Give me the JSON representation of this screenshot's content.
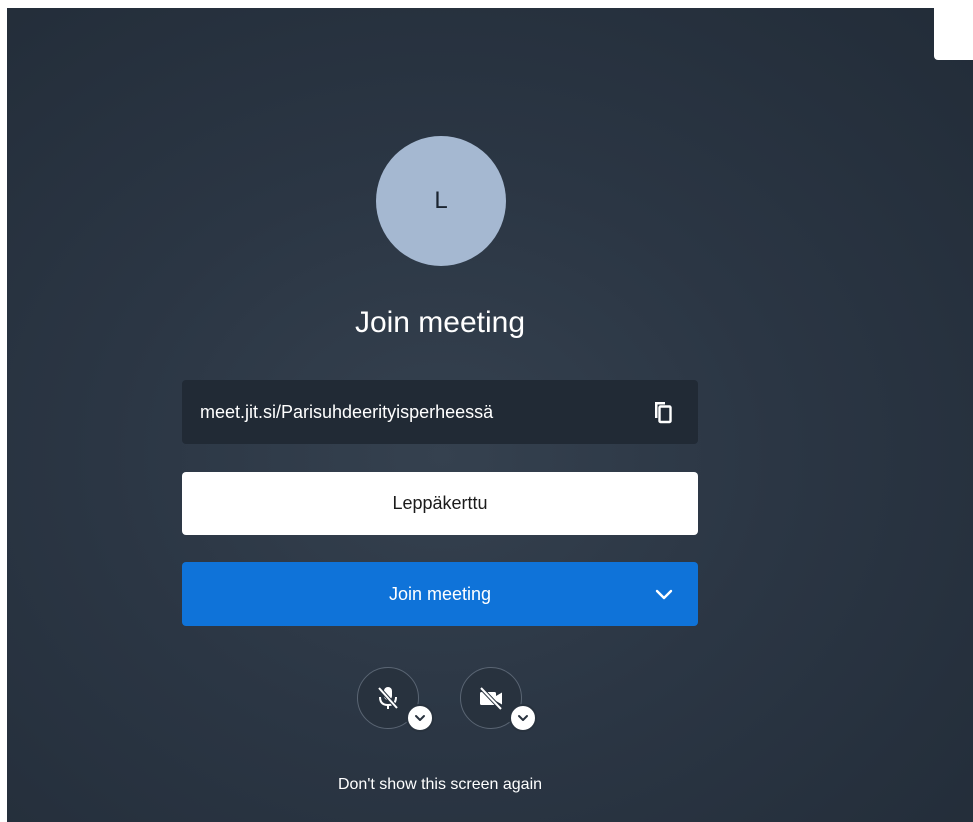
{
  "prejoin": {
    "avatar_initial": "L",
    "title": "Join meeting",
    "meeting_url": "meet.jit.si/Parisuhdeerityisperheessä",
    "display_name_value": "Leppäkerttu",
    "join_button_label": "Join meeting",
    "dont_show_label": "Don't show this screen again"
  },
  "controls": {
    "microphone": {
      "state": "muted",
      "icon": "microphone-off-icon"
    },
    "camera": {
      "state": "off",
      "icon": "camera-off-icon"
    }
  },
  "colors": {
    "background": "#2b3644",
    "avatar": "#a5b8d1",
    "primary_button": "#0f73d9",
    "url_box": "#212a35"
  }
}
